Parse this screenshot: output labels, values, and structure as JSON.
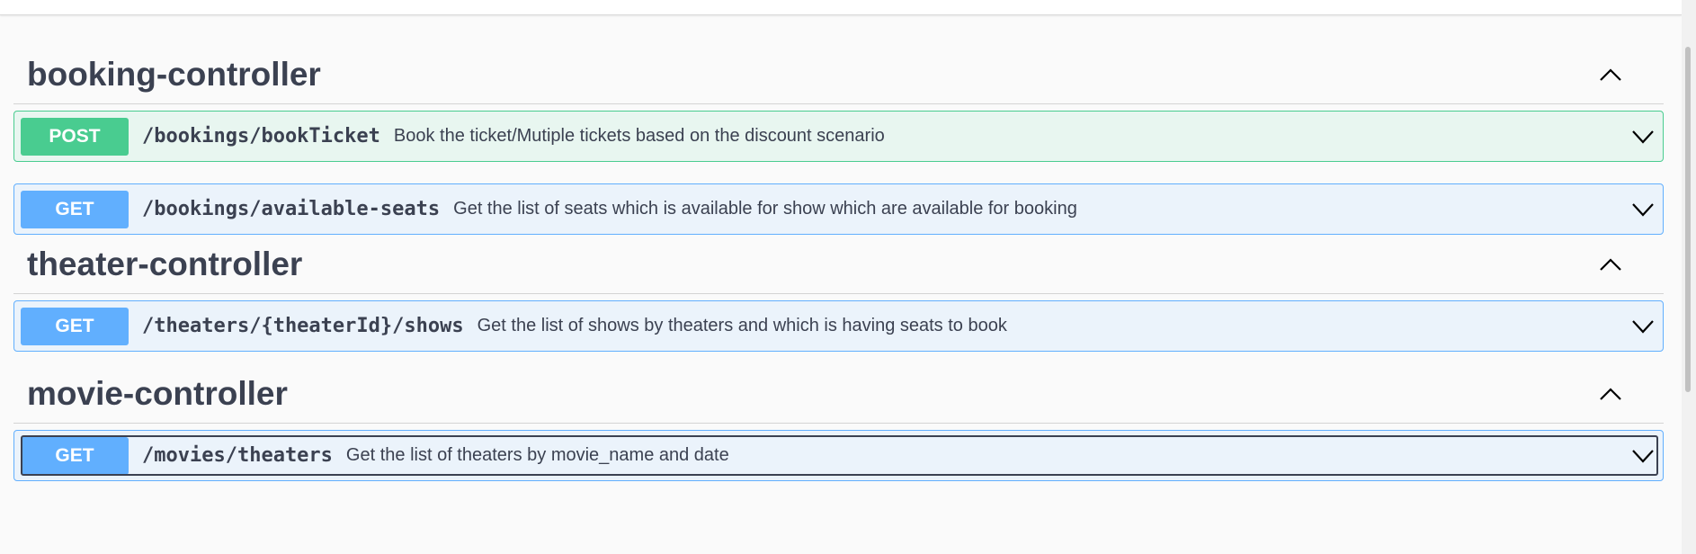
{
  "sections": [
    {
      "title": "booking-controller",
      "operations": [
        {
          "method": "POST",
          "path": "/bookings/bookTicket",
          "summary": "Book the ticket/Mutiple tickets based on the discount scenario"
        },
        {
          "method": "GET",
          "path": "/bookings/available-seats",
          "summary": "Get the list of seats which is available for show which are available for booking"
        }
      ]
    },
    {
      "title": "theater-controller",
      "operations": [
        {
          "method": "GET",
          "path": "/theaters/{theaterId}/shows",
          "summary": "Get the list of shows by theaters and which is having seats to book"
        }
      ]
    },
    {
      "title": "movie-controller",
      "operations": [
        {
          "method": "GET",
          "path": "/movies/theaters",
          "summary": "Get the list of theaters by movie_name and date"
        }
      ]
    }
  ],
  "icons": {
    "collapse": "chevron-up-icon",
    "expand": "chevron-down-icon"
  },
  "colors": {
    "post": "#49cc90",
    "get": "#61affe",
    "text": "#3b4151"
  }
}
